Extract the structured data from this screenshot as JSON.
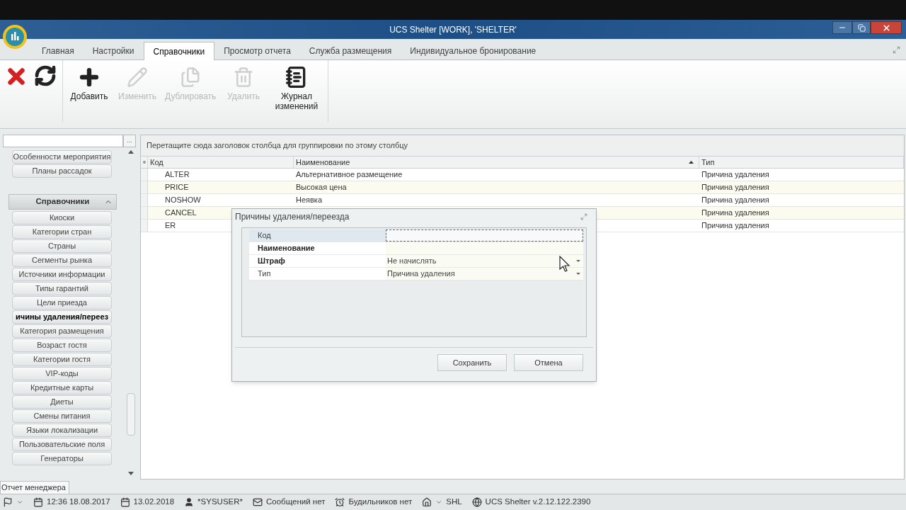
{
  "window": {
    "title": "UCS Shelter [WORK], 'SHELTER'"
  },
  "tabs": [
    {
      "label": "Главная",
      "selected": false
    },
    {
      "label": "Настройки",
      "selected": false
    },
    {
      "label": "Справочники",
      "selected": true
    },
    {
      "label": "Просмотр отчета",
      "selected": false
    },
    {
      "label": "Служба размещения",
      "selected": false
    },
    {
      "label": "Индивидуальное бронирование",
      "selected": false
    }
  ],
  "ribbon": {
    "buttons": [
      {
        "kind": "close",
        "disabled": false
      },
      {
        "kind": "refresh",
        "disabled": false
      },
      {
        "kind": "add",
        "label": "Добавить",
        "disabled": false
      },
      {
        "kind": "edit",
        "label": "Изменить",
        "disabled": true
      },
      {
        "kind": "copy",
        "label": "Дублировать",
        "disabled": true
      },
      {
        "kind": "delete",
        "label": "Удалить",
        "disabled": true
      },
      {
        "kind": "journal",
        "label": "Журнал изменений",
        "disabled": false
      }
    ]
  },
  "sidebar": {
    "search_button": "...",
    "top_items": [
      {
        "label": "Особенности мероприятия",
        "selected": false
      },
      {
        "label": "Планы рассадок",
        "selected": false
      }
    ],
    "group": {
      "label": "Справочники",
      "expanded": true
    },
    "items": [
      {
        "label": "Киоски",
        "selected": false
      },
      {
        "label": "Категории стран",
        "selected": false
      },
      {
        "label": "Страны",
        "selected": false
      },
      {
        "label": "Сегменты рынка",
        "selected": false
      },
      {
        "label": "Источники информации",
        "selected": false
      },
      {
        "label": "Типы гарантий",
        "selected": false
      },
      {
        "label": "Цели приезда",
        "selected": false
      },
      {
        "label": "ичины удаления/переез",
        "selected": true
      },
      {
        "label": "Категория размещения",
        "selected": false
      },
      {
        "label": "Возраст гостя",
        "selected": false
      },
      {
        "label": "Категории гостя",
        "selected": false
      },
      {
        "label": "VIP-коды",
        "selected": false
      },
      {
        "label": "Кредитные карты",
        "selected": false
      },
      {
        "label": "Диеты",
        "selected": false
      },
      {
        "label": "Смены питания",
        "selected": false
      },
      {
        "label": "Языки локализации",
        "selected": false
      },
      {
        "label": "Пользовательские поля",
        "selected": false
      },
      {
        "label": "Генераторы",
        "selected": false
      }
    ]
  },
  "grid": {
    "group_hint": "Перетащите сюда заголовок столбца для группировки по этому столбцу",
    "columns": [
      "Код",
      "Наименование",
      "Тип"
    ],
    "rows": [
      [
        "ALTER",
        "Альтернативное размещение",
        "Причина удаления"
      ],
      [
        "PRICE",
        "Высокая цена",
        "Причина удаления"
      ],
      [
        "NOSHOW",
        "Неявка",
        "Причина удаления"
      ],
      [
        "CANCEL",
        null,
        "Причина удаления"
      ],
      [
        "ER",
        null,
        "Причина удаления"
      ]
    ]
  },
  "dialog": {
    "title": "Причины удаления/переезда",
    "fields": [
      {
        "label": "Код",
        "bold": false,
        "selected": true,
        "dropdown": false
      },
      {
        "label": "Наименование",
        "bold": true,
        "selected": false,
        "dropdown": false
      },
      {
        "label": "Штраф",
        "bold": true,
        "selected": false,
        "value": "Не начислять",
        "dropdown": true
      },
      {
        "label": "Тип",
        "bold": false,
        "selected": false,
        "value": "Причина удаления",
        "dropdown": true
      }
    ],
    "buttons": [
      "Сохранить",
      "Отмена"
    ]
  },
  "bottom_tab": "Отчет менеджера",
  "status_bar": [
    {
      "kind": "flag",
      "dropdown": true
    },
    {
      "kind": "calendar",
      "text": "12:36 18.08.2017"
    },
    {
      "kind": "calendar",
      "text": "13.02.2018"
    },
    {
      "kind": "user",
      "text": "*SYSUSER*"
    },
    {
      "kind": "mail",
      "text": "Сообщений нет"
    },
    {
      "kind": "alarm",
      "text": "Будильников нет"
    },
    {
      "kind": "home",
      "dropdown": true,
      "text": "SHL"
    },
    {
      "kind": "globe",
      "text": "UCS Shelter v.2.12.122.2390"
    }
  ]
}
